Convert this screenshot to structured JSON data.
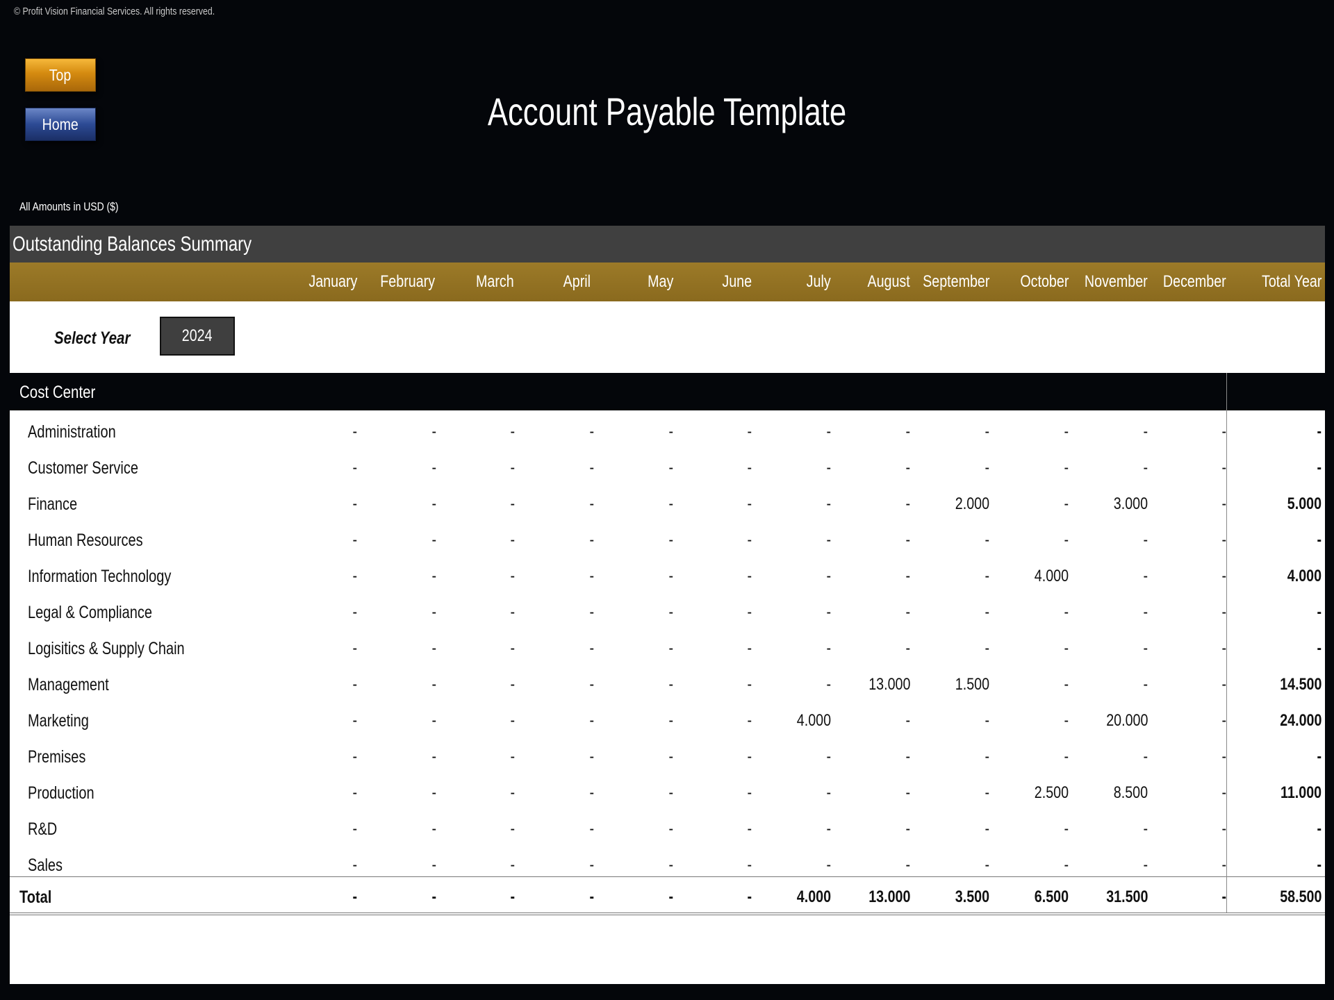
{
  "copyright": "© Profit Vision Financial Services. All rights reserved.",
  "nav": {
    "top_label": "Top",
    "home_label": "Home"
  },
  "title": "Account Payable Template",
  "amounts_note": "All Amounts in  USD ($)",
  "summary_title": "Outstanding Balances Summary",
  "columns": [
    "January",
    "February",
    "March",
    "April",
    "May",
    "June",
    "July",
    "August",
    "September",
    "October",
    "November",
    "December",
    "Total Year"
  ],
  "select_year": {
    "label": "Select Year",
    "value": "2024"
  },
  "cost_center_header": "Cost Center",
  "rows": [
    {
      "name": "Administration",
      "values": [
        "-",
        "-",
        "-",
        "-",
        "-",
        "-",
        "-",
        "-",
        "-",
        "-",
        "-",
        "-",
        "-"
      ]
    },
    {
      "name": "Customer Service",
      "values": [
        "-",
        "-",
        "-",
        "-",
        "-",
        "-",
        "-",
        "-",
        "-",
        "-",
        "-",
        "-",
        "-"
      ]
    },
    {
      "name": "Finance",
      "values": [
        "-",
        "-",
        "-",
        "-",
        "-",
        "-",
        "-",
        "-",
        "2.000",
        "-",
        "3.000",
        "-",
        "5.000"
      ]
    },
    {
      "name": "Human Resources",
      "values": [
        "-",
        "-",
        "-",
        "-",
        "-",
        "-",
        "-",
        "-",
        "-",
        "-",
        "-",
        "-",
        "-"
      ]
    },
    {
      "name": "Information Technology",
      "values": [
        "-",
        "-",
        "-",
        "-",
        "-",
        "-",
        "-",
        "-",
        "-",
        "4.000",
        "-",
        "-",
        "4.000"
      ]
    },
    {
      "name": "Legal & Compliance",
      "values": [
        "-",
        "-",
        "-",
        "-",
        "-",
        "-",
        "-",
        "-",
        "-",
        "-",
        "-",
        "-",
        "-"
      ]
    },
    {
      "name": "Logisitics & Supply Chain",
      "values": [
        "-",
        "-",
        "-",
        "-",
        "-",
        "-",
        "-",
        "-",
        "-",
        "-",
        "-",
        "-",
        "-"
      ]
    },
    {
      "name": "Management",
      "values": [
        "-",
        "-",
        "-",
        "-",
        "-",
        "-",
        "-",
        "13.000",
        "1.500",
        "-",
        "-",
        "-",
        "14.500"
      ]
    },
    {
      "name": "Marketing",
      "values": [
        "-",
        "-",
        "-",
        "-",
        "-",
        "-",
        "4.000",
        "-",
        "-",
        "-",
        "20.000",
        "-",
        "24.000"
      ]
    },
    {
      "name": "Premises",
      "values": [
        "-",
        "-",
        "-",
        "-",
        "-",
        "-",
        "-",
        "-",
        "-",
        "-",
        "-",
        "-",
        "-"
      ]
    },
    {
      "name": "Production",
      "values": [
        "-",
        "-",
        "-",
        "-",
        "-",
        "-",
        "-",
        "-",
        "-",
        "2.500",
        "8.500",
        "-",
        "11.000"
      ]
    },
    {
      "name": "R&D",
      "values": [
        "-",
        "-",
        "-",
        "-",
        "-",
        "-",
        "-",
        "-",
        "-",
        "-",
        "-",
        "-",
        "-"
      ]
    },
    {
      "name": "Sales",
      "values": [
        "-",
        "-",
        "-",
        "-",
        "-",
        "-",
        "-",
        "-",
        "-",
        "-",
        "-",
        "-",
        "-"
      ]
    }
  ],
  "total": {
    "name": "Total",
    "values": [
      "-",
      "-",
      "-",
      "-",
      "-",
      "-",
      "4.000",
      "13.000",
      "3.500",
      "6.500",
      "31.500",
      "-",
      "58.500"
    ]
  }
}
